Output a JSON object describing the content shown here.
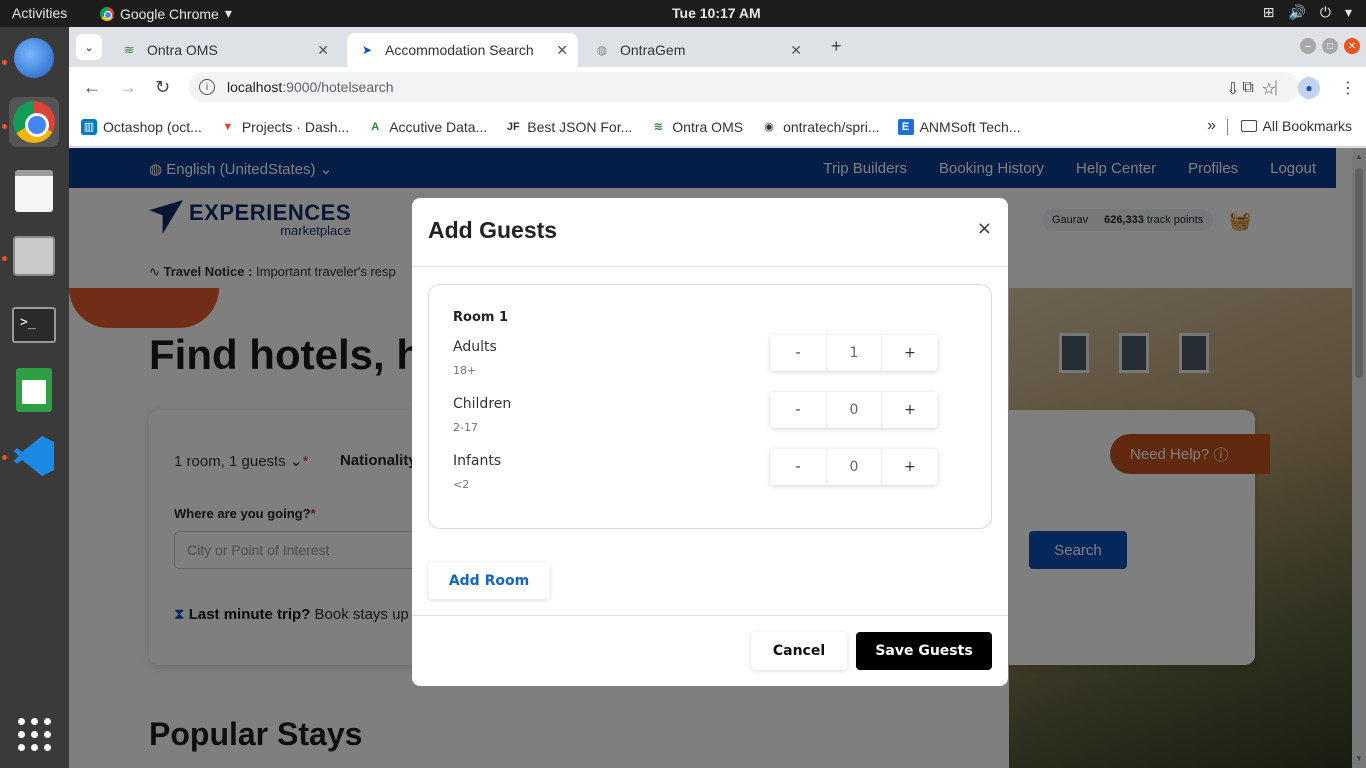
{
  "system": {
    "activities": "Activities",
    "app_name": "Google Chrome",
    "clock": "Tue 10:17 AM"
  },
  "tabs": [
    {
      "label": "Ontra OMS",
      "icon": "ontra-oms-favicon"
    },
    {
      "label": "Accommodation Search",
      "icon": "experiences-favicon"
    },
    {
      "label": "OntraGem",
      "icon": "globe-icon"
    }
  ],
  "address": {
    "host": "localhost",
    "path": ":9000/hotelsearch"
  },
  "bookmarks": [
    {
      "label": "Octashop (oct...",
      "icon": "trello-icon",
      "color": "#0079bf"
    },
    {
      "label": "Projects · Dash...",
      "icon": "gitlab-icon",
      "color": "#e24329"
    },
    {
      "label": "Accutive Data...",
      "icon": "accutive-icon",
      "color": "#2e7d32"
    },
    {
      "label": "Best JSON For...",
      "icon": "jf-icon",
      "color": "#222222"
    },
    {
      "label": "Ontra OMS",
      "icon": "ontra-icon",
      "color": "#2e7d32"
    },
    {
      "label": "ontratech/spri...",
      "icon": "github-icon",
      "color": "#222222"
    },
    {
      "label": "ANMSoft Tech...",
      "icon": "anmsoft-icon",
      "color": "#1e6fd9"
    }
  ],
  "all_bookmarks": "All Bookmarks",
  "site": {
    "language": "English (UnitedStates)",
    "nav": [
      "Trip Builders",
      "Booking History",
      "Help Center",
      "Profiles",
      "Logout"
    ],
    "logo_name": "EXPERIENCES",
    "logo_sub": "marketplace",
    "user_name": "Gaurav",
    "points": "626,333",
    "points_label": "track points",
    "notice_label": "Travel Notice :",
    "notice_text": "Important traveler's resp",
    "hero_title": "Find hotels, ho",
    "rooms_summary": "1 room, 1 guests",
    "nationality": "Nationality",
    "where_label": "Where are you going?",
    "where_placeholder": "City or Point of Interest",
    "search_label": "Search",
    "help_label": "Need Help?",
    "lastmin_bold": "Last minute trip?",
    "lastmin_text": "Book stays up",
    "popular_title": "Popular Stays"
  },
  "modal": {
    "title": "Add Guests",
    "room_title": "Room 1",
    "guests": [
      {
        "label": "Adults",
        "hint": "18+",
        "value": "1"
      },
      {
        "label": "Children",
        "hint": "2-17",
        "value": "0"
      },
      {
        "label": "Infants",
        "hint": "<2",
        "value": "0"
      }
    ],
    "minus": "-",
    "plus": "+",
    "add_room": "Add Room",
    "cancel": "Cancel",
    "save": "Save Guests"
  },
  "colors": {
    "accent_blue": "#0a3d8f",
    "save_button": "#000000",
    "add_room_link": "#1565c0"
  }
}
